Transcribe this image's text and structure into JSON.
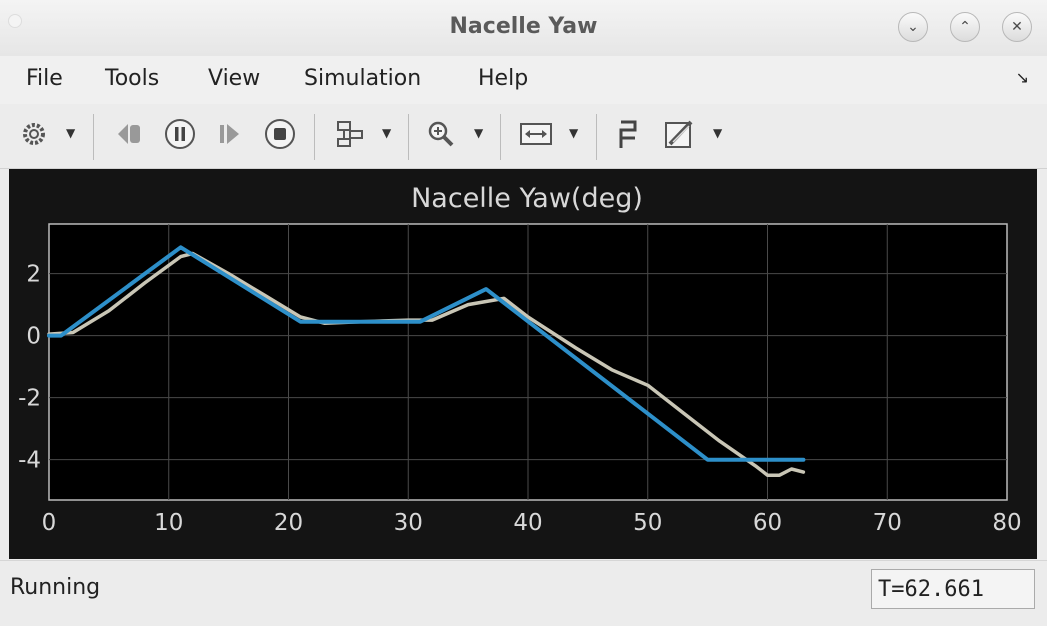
{
  "window": {
    "title": "Nacelle Yaw"
  },
  "menu": {
    "file": "File",
    "tools": "Tools",
    "view": "View",
    "simulation": "Simulation",
    "help": "Help"
  },
  "toolbar": {
    "icons": [
      "gear-icon",
      "step-back-icon",
      "pause-icon",
      "step-forward-icon",
      "stop-icon",
      "signal-hierarchy-icon",
      "zoom-in-icon",
      "fit-to-view-icon",
      "cursor-measure-icon",
      "edit-style-icon"
    ]
  },
  "status": {
    "text": "Running",
    "time": "T=62.661"
  },
  "colors": {
    "plot_bg": "#000000",
    "plot_outer": "#141414",
    "grid": "#4a4a4a",
    "axis_text": "#d8d8d8",
    "series_blue": "#2d8fc9",
    "series_gray": "#c9c6b6"
  },
  "chart_data": {
    "type": "line",
    "title": "Nacelle Yaw(deg)",
    "xlim": [
      0,
      80
    ],
    "ylim": [
      -5.3,
      3.6
    ],
    "xticks": [
      0,
      10,
      20,
      30,
      40,
      50,
      60,
      70,
      80
    ],
    "yticks": [
      2,
      0,
      -2,
      -4
    ],
    "grid": true,
    "series": [
      {
        "color": "#2d8fc9",
        "x": [
          0,
          1,
          11,
          21,
          31,
          36.5,
          55,
          63
        ],
        "y": [
          0,
          0,
          2.85,
          0.45,
          0.45,
          1.5,
          -4.0,
          -4.0
        ]
      },
      {
        "color": "#c9c6b6",
        "x": [
          0,
          2,
          5,
          8,
          11,
          12,
          15,
          18,
          21,
          23,
          26,
          30,
          32,
          35,
          38,
          40,
          44,
          47,
          50,
          53,
          56,
          59,
          60,
          61,
          62,
          63
        ],
        "y": [
          0.05,
          0.1,
          0.8,
          1.7,
          2.55,
          2.65,
          2.0,
          1.3,
          0.6,
          0.4,
          0.45,
          0.5,
          0.5,
          1.0,
          1.2,
          0.6,
          -0.4,
          -1.1,
          -1.6,
          -2.5,
          -3.4,
          -4.2,
          -4.5,
          -4.5,
          -4.3,
          -4.4
        ]
      }
    ]
  }
}
